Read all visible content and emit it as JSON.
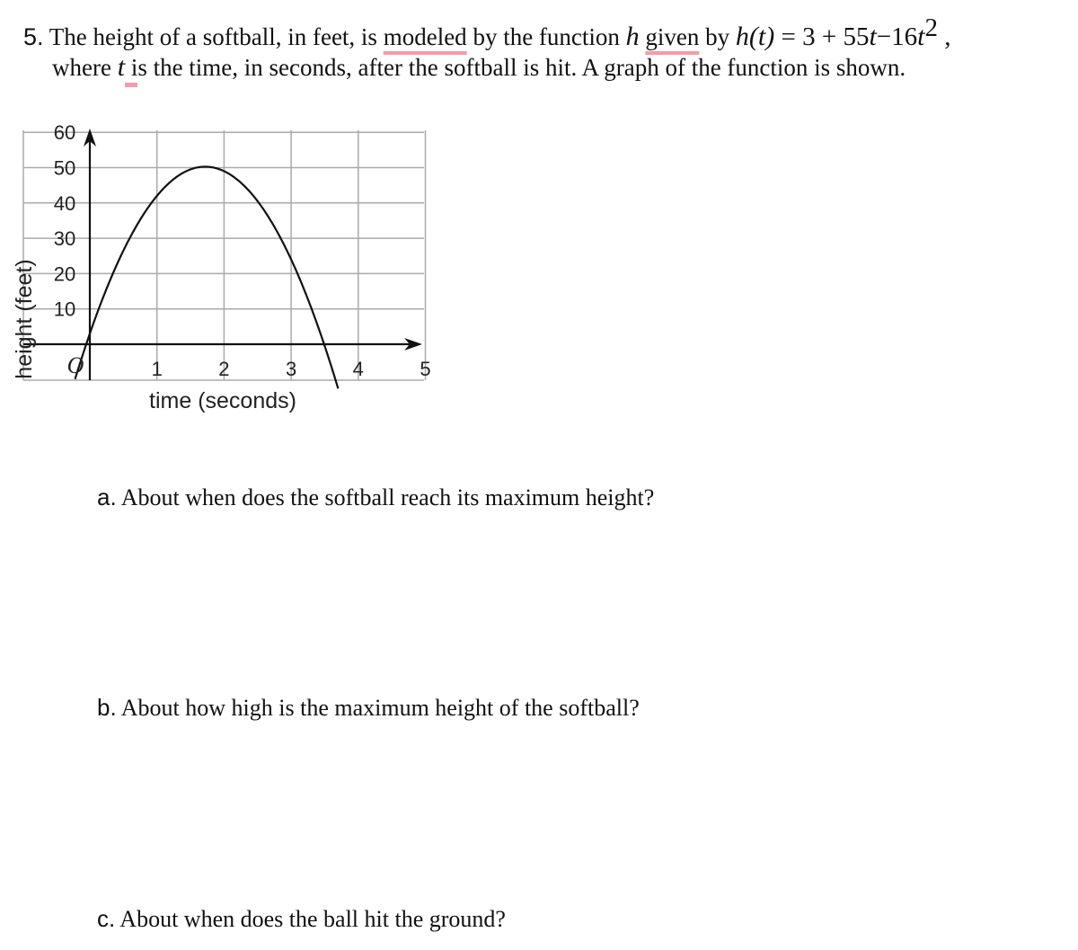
{
  "problem": {
    "number": "5.",
    "line1_part1": " The height of a softball, in feet, is ",
    "line1_underlined1": "modeled",
    "line1_part2": " by the function ",
    "function_name": "h",
    "line1_underlined2": "given",
    "line1_part3": " by ",
    "equation_lhs": "h(t)",
    "equation_eq": " = 3 + 55",
    "equation_t1": "t",
    "equation_minus": "−16",
    "equation_t2": "t",
    "equation_exp": "2",
    "equation_comma": " ,",
    "line2_part1": "where ",
    "line2_var": "t",
    "line2_part2": " is the time, in seconds, after the softball is hit. A graph of the function is shown."
  },
  "questions": [
    {
      "letter": "a.",
      "text": " About when does the softball reach its maximum height?"
    },
    {
      "letter": "b.",
      "text": " About how high is the maximum height of the softball?"
    },
    {
      "letter": "c.",
      "text": " About when does the ball hit the ground?"
    }
  ],
  "chart_data": {
    "type": "line",
    "title": "",
    "function": "h(t) = 3 + 55t - 16t^2",
    "xlabel": "time (seconds)",
    "ylabel": "height (feet)",
    "xlim": [
      -1,
      5
    ],
    "ylim": [
      -10,
      60
    ],
    "x_ticks": [
      "1",
      "2",
      "3",
      "4",
      "5"
    ],
    "y_ticks": [
      "10",
      "20",
      "30",
      "40",
      "50",
      "60"
    ],
    "origin_label": "O",
    "grid": true,
    "series": [
      {
        "name": "h(t)",
        "coefficients": {
          "a": -16,
          "b": 55,
          "c": 3
        },
        "t_range": [
          -0.22,
          3.7
        ]
      }
    ],
    "key_points": {
      "vertex": {
        "t": 1.72,
        "h": 50.3
      },
      "t_intercept": 3.49,
      "h_intercept": 3
    }
  }
}
